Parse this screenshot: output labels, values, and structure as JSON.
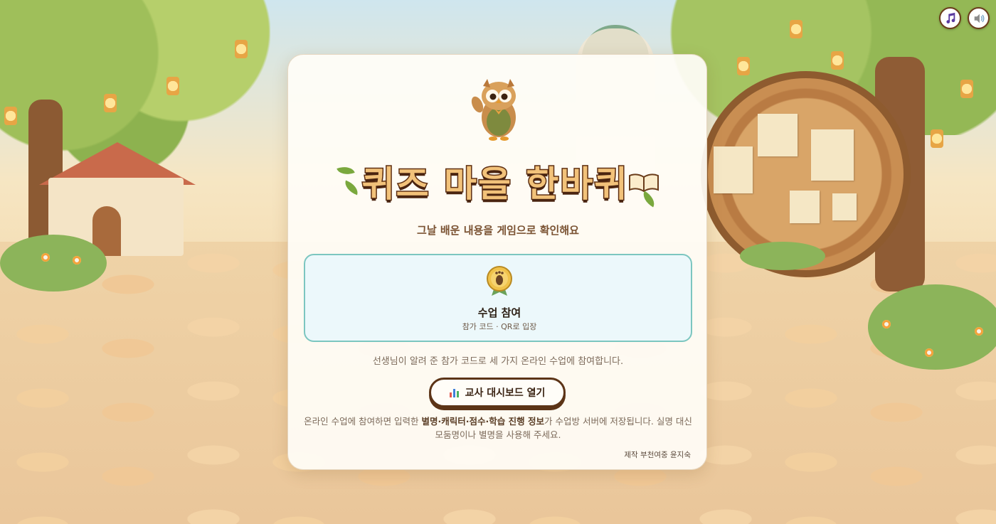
{
  "header": {
    "music_button": {
      "icon": "music-note-icon"
    },
    "sound_button": {
      "icon": "speaker-icon"
    }
  },
  "logo": {
    "title": "퀴즈 마을 한바퀴",
    "mascot": "owl-mascot"
  },
  "subtitle": "그날 배운 내용을 게임으로 확인해요",
  "join_card": {
    "title": "수업 참여",
    "subtitle": "참가 코드 · QR로 입장",
    "icon": "footprint-medal-icon"
  },
  "description": "선생님이 알려 준 참가 코드로 세 가지 온라인 수업에 참여합니다.",
  "dashboard_button": {
    "label": "교사 대시보드 열기",
    "icon": "bar-chart-icon"
  },
  "notice": {
    "prefix": "온라인 수업에 참여하면 입력한 ",
    "bold": "별명·캐릭터·점수·학습 진행 정보",
    "suffix": "가 수업방 서버에 저장됩니다. 실명 대신 모둠명이나 별명을 사용해 주세요."
  },
  "credit": "제작 부천여중 윤지숙",
  "colors": {
    "accent_teal": "#7cc6c0",
    "join_bg": "#ecf8fb",
    "brown": "#5c3417",
    "logo_fill": "#f2c27a"
  }
}
